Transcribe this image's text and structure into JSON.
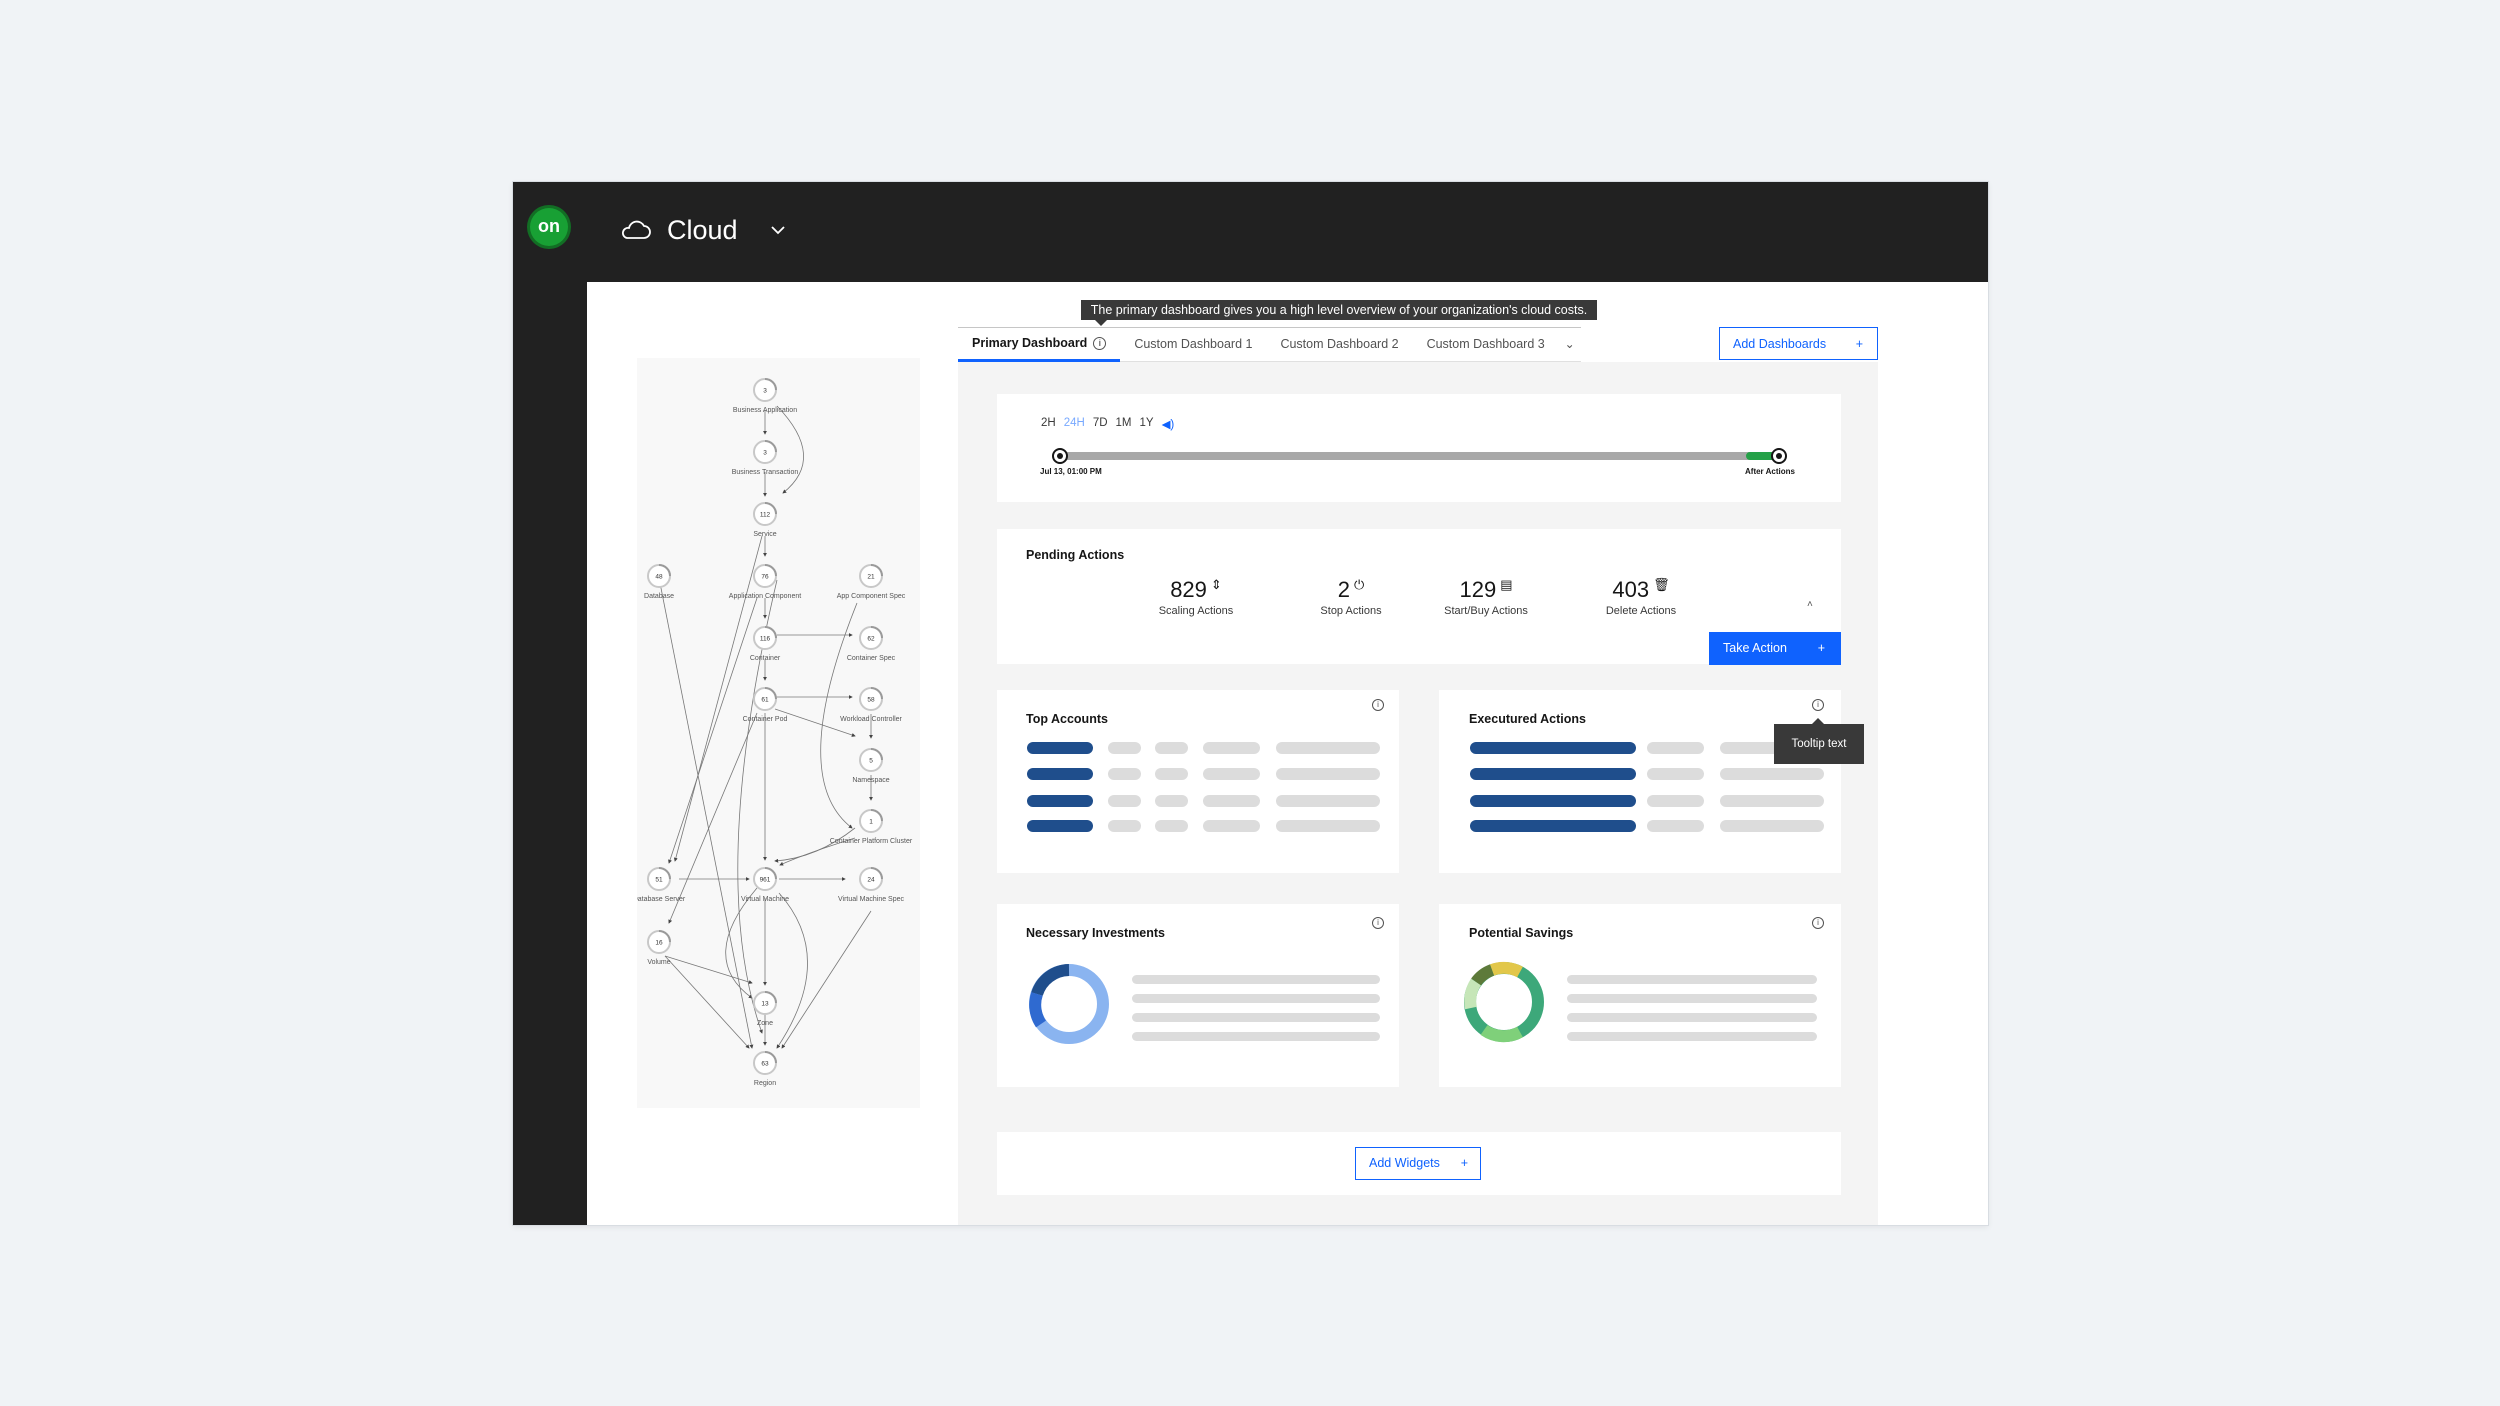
{
  "header": {
    "logo_text": "on",
    "app_title": "Cloud",
    "cloud_icon": "cloud-icon",
    "dropdown_icon": "chevron-down-icon"
  },
  "tooltip_banner": "The primary dashboard gives you a high level overview of your organization's cloud costs.",
  "tabs": [
    {
      "label": "Primary Dashboard"
    },
    {
      "label": "Custom Dashboard 1"
    },
    {
      "label": "Custom Dashboard 2"
    },
    {
      "label": "Custom Dashboard 3"
    }
  ],
  "add_dashboards": {
    "label": "Add Dashboards",
    "icon": "+"
  },
  "timeline": {
    "ranges": [
      "2H",
      "24H",
      "7D",
      "1M",
      "1Y"
    ],
    "selected": "24H",
    "start_label": "Jul 13, 01:00 PM",
    "end_label": "After Actions"
  },
  "pending_actions": {
    "title": "Pending Actions",
    "metrics": [
      {
        "value": "829",
        "label": "Scaling Actions",
        "icon": "⇕"
      },
      {
        "value": "2",
        "label": "Stop Actions",
        "icon": "⏻"
      },
      {
        "value": "129",
        "label": "Start/Buy Actions",
        "icon": "▤"
      },
      {
        "value": "403",
        "label": "Delete Actions",
        "icon": "🗑"
      }
    ],
    "take_action": {
      "label": "Take Action",
      "icon": "+"
    }
  },
  "cards": {
    "top_accounts": {
      "title": "Top Accounts"
    },
    "executed_actions": {
      "title": "Executured Actions",
      "tooltip": "Tooltip text"
    },
    "necessary_investments": {
      "title": "Necessary Investments"
    },
    "potential_savings": {
      "title": "Potential Savings"
    }
  },
  "add_widgets": {
    "label": "Add Widgets",
    "icon": "+"
  },
  "topology": {
    "nodes": [
      {
        "name": "Business Application",
        "count": "3"
      },
      {
        "name": "Business Transaction",
        "count": "3"
      },
      {
        "name": "Service",
        "count": "112"
      },
      {
        "name": "Database",
        "count": "48"
      },
      {
        "name": "Application Component",
        "count": "76"
      },
      {
        "name": "App Component Spec",
        "count": "21"
      },
      {
        "name": "Container",
        "count": "116"
      },
      {
        "name": "Container Spec",
        "count": "62"
      },
      {
        "name": "Container Pod",
        "count": "61"
      },
      {
        "name": "Workload Controller",
        "count": "58"
      },
      {
        "name": "Namespace",
        "count": "5"
      },
      {
        "name": "Container Platform Cluster",
        "count": "1"
      },
      {
        "name": "Database Server",
        "count": "51"
      },
      {
        "name": "Virtual Machine",
        "count": "961"
      },
      {
        "name": "Virtual Machine Spec",
        "count": "24"
      },
      {
        "name": "Volume",
        "count": "16"
      },
      {
        "name": "Zone",
        "count": "13"
      },
      {
        "name": "Region",
        "count": "63"
      }
    ]
  },
  "colors": {
    "accent": "#0f62fe",
    "dark_bar": "#212121",
    "brand_green": "#18a034",
    "bar_blue": "#1f4e8c"
  }
}
